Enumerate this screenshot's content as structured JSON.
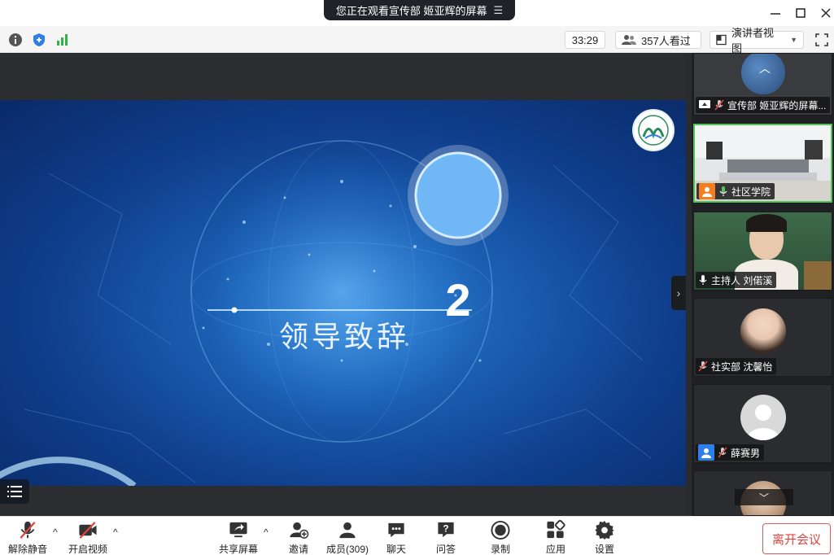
{
  "titlebar": {
    "sharing_banner": "您正在观看宣传部 姬亚辉的屏幕",
    "menu_icon": "list-icon",
    "controls": [
      "minimize-icon",
      "maximize-icon",
      "close-icon"
    ]
  },
  "infobar": {
    "icons": [
      "info-icon",
      "shield-icon",
      "signal-icon"
    ],
    "timer": "33:29",
    "viewers": "357人看过",
    "view_mode": "演讲者视图",
    "fullscreen_icon": "fullscreen-icon"
  },
  "slide": {
    "number": "2",
    "heading": "领导致辞"
  },
  "participants": [
    {
      "label": "宣传部 姬亚辉的屏幕...",
      "mic": "muted",
      "badge": "share-screen-icon"
    },
    {
      "label": "社区学院",
      "mic": "active",
      "badge": "person-icon",
      "badge_color": "#f47d20"
    },
    {
      "label": "主持人 刘偌溪",
      "mic": "on",
      "badge": ""
    },
    {
      "label": "社实部 沈馨怡",
      "mic": "muted",
      "badge": ""
    },
    {
      "label": "薛赛男",
      "mic": "muted",
      "badge": "person-icon",
      "badge_color": "#2f7fe8"
    }
  ],
  "toolbar": {
    "mute_label": "解除静音",
    "video_label": "开启视频",
    "share_label": "共享屏幕",
    "invite_label": "邀请",
    "members_label": "成员(309)",
    "chat_label": "聊天",
    "qa_label": "问答",
    "record_label": "录制",
    "apps_label": "应用",
    "settings_label": "设置",
    "leave_label": "离开会议"
  },
  "colors": {
    "accent_red": "#e0443f",
    "active_border": "#56c25a",
    "badge_orange": "#f47d20",
    "badge_blue": "#2f7fe8"
  }
}
